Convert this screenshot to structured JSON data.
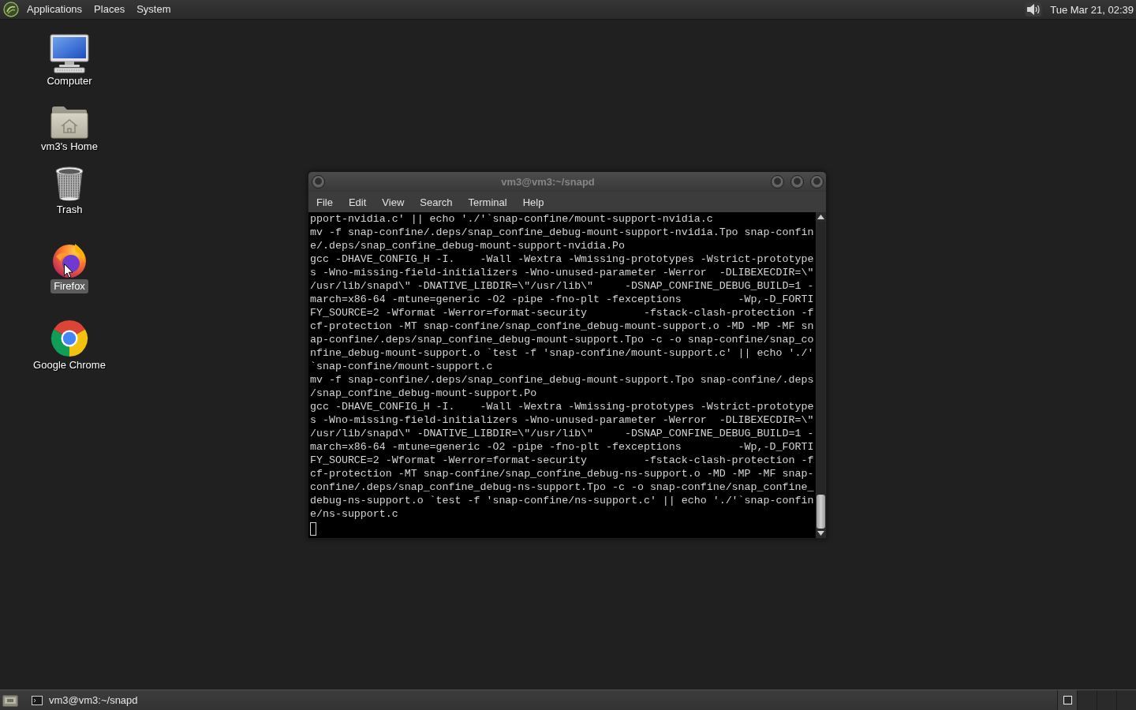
{
  "top_panel": {
    "menus": [
      "Applications",
      "Places",
      "System"
    ],
    "clock": "Tue Mar 21, 02:39"
  },
  "desktop_icons": [
    {
      "kind": "computer",
      "label": "Computer",
      "selected": false
    },
    {
      "kind": "home",
      "label": "vm3's Home",
      "selected": false
    },
    {
      "kind": "trash",
      "label": "Trash",
      "selected": false
    },
    {
      "kind": "firefox",
      "label": "Firefox",
      "selected": true
    },
    {
      "kind": "chrome",
      "label": "Google Chrome",
      "selected": false
    }
  ],
  "terminal": {
    "title": "vm3@vm3:~/snapd",
    "focused": false,
    "menus": [
      "File",
      "Edit",
      "View",
      "Search",
      "Terminal",
      "Help"
    ],
    "lines": [
      "pport-nvidia.c' || echo './'`snap-confine/mount-support-nvidia.c",
      "mv -f snap-confine/.deps/snap_confine_debug-mount-support-nvidia.Tpo snap-confin",
      "e/.deps/snap_confine_debug-mount-support-nvidia.Po",
      "gcc -DHAVE_CONFIG_H -I.    -Wall -Wextra -Wmissing-prototypes -Wstrict-prototype",
      "s -Wno-missing-field-initializers -Wno-unused-parameter -Werror  -DLIBEXECDIR=\\\"",
      "/usr/lib/snapd\\\" -DNATIVE_LIBDIR=\\\"/usr/lib\\\"     -DSNAP_CONFINE_DEBUG_BUILD=1 -",
      "march=x86-64 -mtune=generic -O2 -pipe -fno-plt -fexceptions         -Wp,-D_FORTI",
      "FY_SOURCE=2 -Wformat -Werror=format-security         -fstack-clash-protection -f",
      "cf-protection -MT snap-confine/snap_confine_debug-mount-support.o -MD -MP -MF sn",
      "ap-confine/.deps/snap_confine_debug-mount-support.Tpo -c -o snap-confine/snap_co",
      "nfine_debug-mount-support.o `test -f 'snap-confine/mount-support.c' || echo './'",
      "`snap-confine/mount-support.c",
      "mv -f snap-confine/.deps/snap_confine_debug-mount-support.Tpo snap-confine/.deps",
      "/snap_confine_debug-mount-support.Po",
      "gcc -DHAVE_CONFIG_H -I.    -Wall -Wextra -Wmissing-prototypes -Wstrict-prototype",
      "s -Wno-missing-field-initializers -Wno-unused-parameter -Werror  -DLIBEXECDIR=\\\"",
      "/usr/lib/snapd\\\" -DNATIVE_LIBDIR=\\\"/usr/lib\\\"     -DSNAP_CONFINE_DEBUG_BUILD=1 -",
      "march=x86-64 -mtune=generic -O2 -pipe -fno-plt -fexceptions         -Wp,-D_FORTI",
      "FY_SOURCE=2 -Wformat -Werror=format-security         -fstack-clash-protection -f",
      "cf-protection -MT snap-confine/snap_confine_debug-ns-support.o -MD -MP -MF snap-",
      "confine/.deps/snap_confine_debug-ns-support.Tpo -c -o snap-confine/snap_confine_",
      "debug-ns-support.o `test -f 'snap-confine/ns-support.c' || echo './'`snap-confin",
      "e/ns-support.c"
    ]
  },
  "bottom_panel": {
    "tasks": [
      {
        "label": "vm3@vm3:~/snapd",
        "selected": false
      }
    ],
    "workspaces": [
      {
        "selected": true,
        "has_window": true
      },
      {
        "selected": false,
        "has_window": false
      },
      {
        "selected": false,
        "has_window": false
      },
      {
        "selected": false,
        "has_window": false
      }
    ]
  }
}
